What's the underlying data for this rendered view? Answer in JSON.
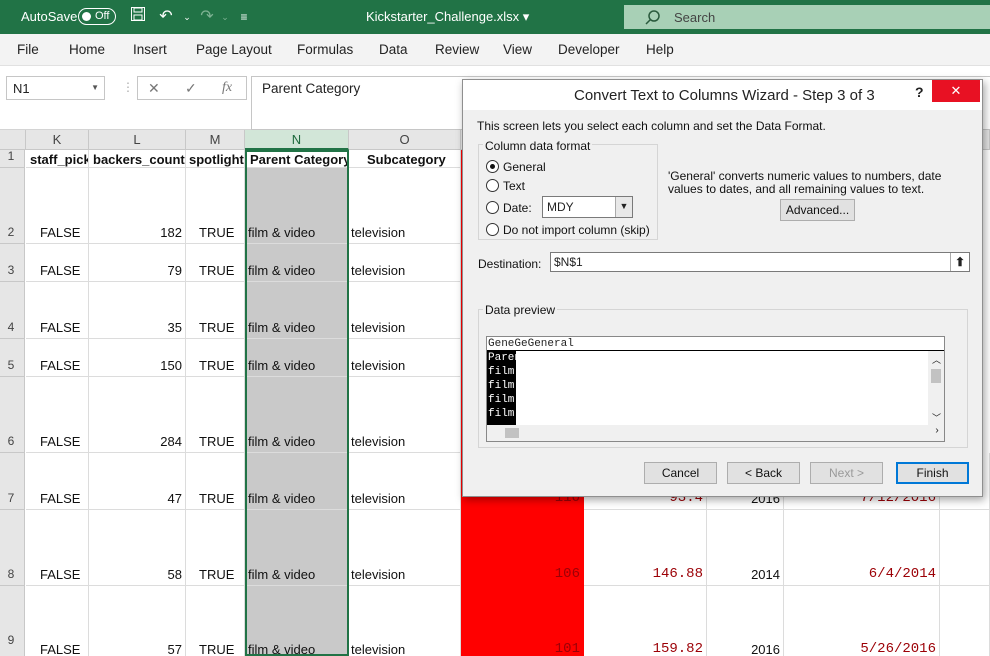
{
  "titlebar": {
    "autosave_label": "AutoSave",
    "autosave_state": "Off",
    "filename": "Kickstarter_Challenge.xlsx",
    "search_placeholder": "Search"
  },
  "menu": [
    "File",
    "Home",
    "Insert",
    "Page Layout",
    "Formulas",
    "Data",
    "Review",
    "View",
    "Developer",
    "Help"
  ],
  "formula_bar": {
    "name_box": "N1",
    "cancel_icon": "✕",
    "enter_icon": "✓",
    "fx_icon": "fx",
    "content": "Parent Category"
  },
  "columns": [
    {
      "letter": "K",
      "header": "staff_pick"
    },
    {
      "letter": "L",
      "header": "backers_count"
    },
    {
      "letter": "M",
      "header": "spotlight"
    },
    {
      "letter": "N",
      "header": "Parent Category"
    },
    {
      "letter": "O",
      "header": "Subcategory"
    }
  ],
  "rows": [
    {
      "num": "1"
    },
    {
      "num": "2",
      "staff_pick": "FALSE",
      "backers_count": "182",
      "spotlight": "TRUE",
      "parent": "film & video",
      "sub": "television"
    },
    {
      "num": "3",
      "staff_pick": "FALSE",
      "backers_count": "79",
      "spotlight": "TRUE",
      "parent": "film & video",
      "sub": "television"
    },
    {
      "num": "4",
      "staff_pick": "FALSE",
      "backers_count": "35",
      "spotlight": "TRUE",
      "parent": "film & video",
      "sub": "television"
    },
    {
      "num": "5",
      "staff_pick": "FALSE",
      "backers_count": "150",
      "spotlight": "TRUE",
      "parent": "film & video",
      "sub": "television"
    },
    {
      "num": "6",
      "staff_pick": "FALSE",
      "backers_count": "284",
      "spotlight": "TRUE",
      "parent": "film & video",
      "sub": "television"
    },
    {
      "num": "7",
      "staff_pick": "FALSE",
      "backers_count": "47",
      "spotlight": "TRUE",
      "parent": "film & video",
      "sub": "television",
      "p": "110",
      "q": "93.4",
      "r": "2016",
      "s": "7/12/2016"
    },
    {
      "num": "8",
      "staff_pick": "FALSE",
      "backers_count": "58",
      "spotlight": "TRUE",
      "parent": "film & video",
      "sub": "television",
      "p": "106",
      "q": "146.88",
      "r": "2014",
      "s": "6/4/2014"
    },
    {
      "num": "9",
      "staff_pick": "FALSE",
      "backers_count": "57",
      "spotlight": "TRUE",
      "parent": "film & video",
      "sub": "television",
      "p": "101",
      "q": "159.82",
      "r": "2016",
      "s": "5/26/2016"
    }
  ],
  "dialog": {
    "title": "Convert Text to Columns Wizard - Step 3 of 3",
    "help": "?",
    "close": "✕",
    "intro": "This screen lets you select each column and set the Data Format.",
    "column_format_label": "Column data format",
    "opt_general": "General",
    "opt_text": "Text",
    "opt_date": "Date:",
    "date_value": "MDY",
    "opt_skip": "Do not import column (skip)",
    "general_info": "'General' converts numeric values to numbers, date values to dates, and all remaining values to text.",
    "advanced": "Advanced...",
    "destination_label": "Destination:",
    "destination_value": "$N$1",
    "preview_label": "Data preview",
    "preview_header": "GeneGeGeneral",
    "preview_lines": [
      "Parent Category",
      "film & video",
      "film & video",
      "film & video",
      "film & video"
    ],
    "btn_cancel": "Cancel",
    "btn_back": "< Back",
    "btn_next": "Next >",
    "btn_finish": "Finish"
  }
}
